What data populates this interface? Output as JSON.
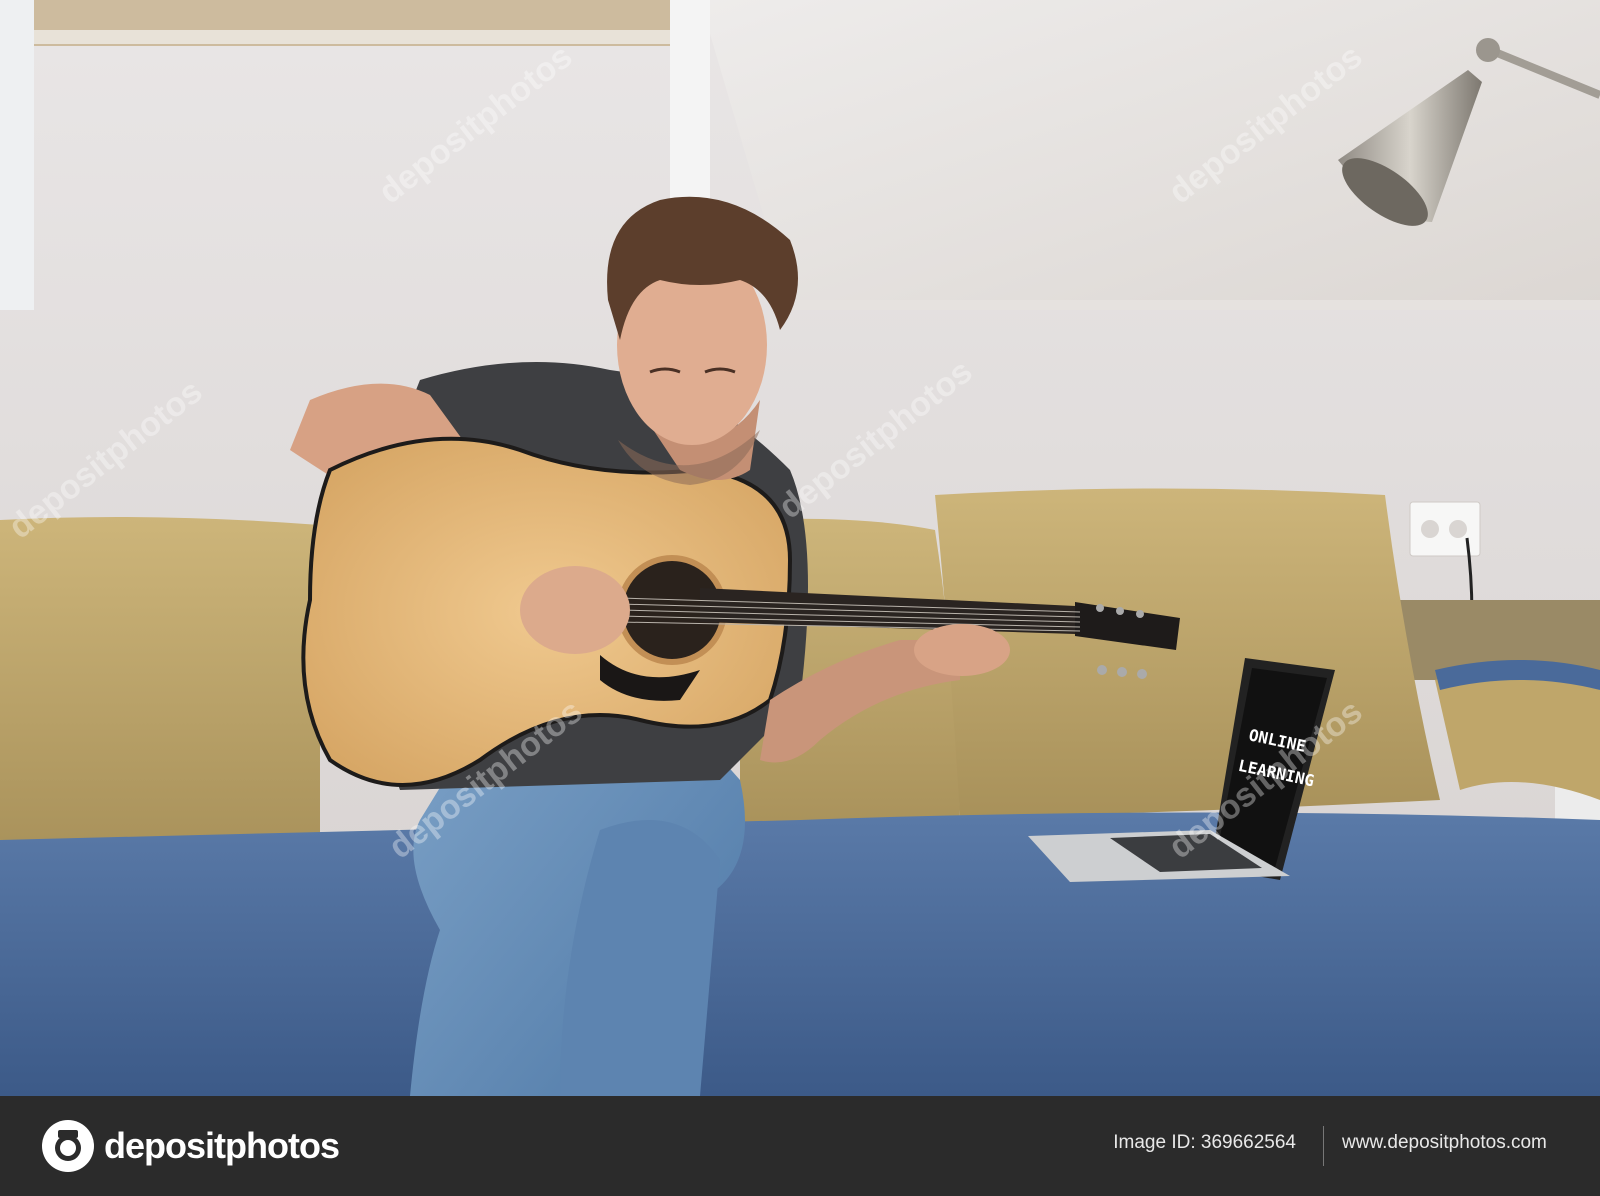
{
  "laptop_screen": {
    "line1": "ONLINE",
    "line2": "LEARNING"
  },
  "watermark": {
    "text": "depositphotos"
  },
  "footer": {
    "brand": "depositphotos",
    "image_id_label": "Image ID: 369662564",
    "site_url": "www.depositphotos.com"
  },
  "colors": {
    "wall": "#dcd8d6",
    "sofa_seat": "#4a6a9a",
    "cushion": "#bfa66a",
    "guitar_top": "#e3b77c",
    "footer_bg": "#2b2b2b"
  }
}
